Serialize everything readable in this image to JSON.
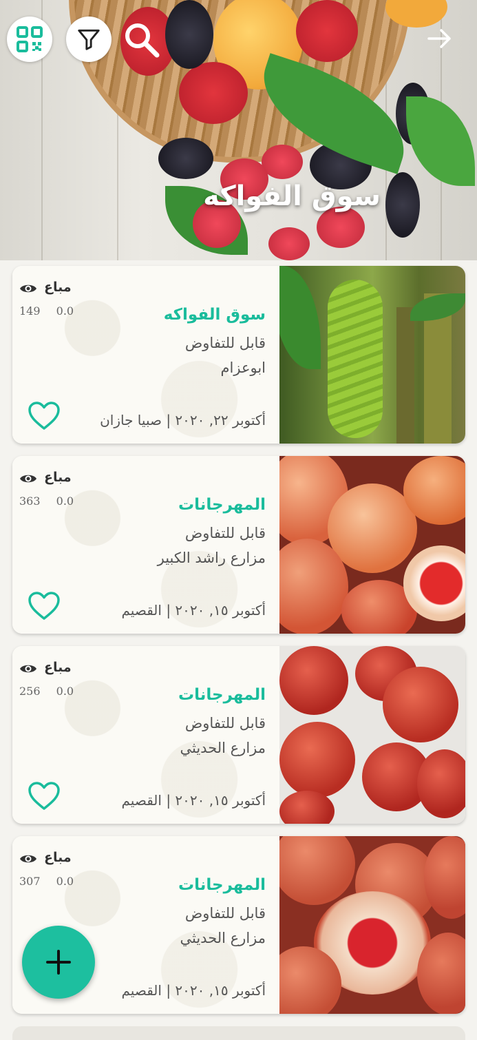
{
  "header": {
    "title": "سوق الفواكه",
    "icons": [
      "qr-code-icon",
      "filter-icon",
      "search-icon",
      "arrow-right-icon"
    ]
  },
  "products": [
    {
      "title": "سوق الفواكه",
      "negotiable": "قابل للتفاوض",
      "seller": "ابوعزام",
      "meta": "أكتوبر ٢٢, ٢٠٢٠ | صبيا جازان",
      "sold_label": "مباع",
      "rating": "0.0",
      "views": "149",
      "image": "bananas"
    },
    {
      "title": "المهرجانات",
      "negotiable": "قابل للتفاوض",
      "seller": "مزارع راشد الكبير",
      "meta": "أكتوبر ١٥, ٢٠٢٠ | القصيم",
      "sold_label": "مباع",
      "rating": "0.0",
      "views": "363",
      "image": "pomegranates"
    },
    {
      "title": "المهرجانات",
      "negotiable": "قابل للتفاوض",
      "seller": "مزارع الحديثي",
      "meta": "أكتوبر ١٥, ٢٠٢٠ | القصيم",
      "sold_label": "مباع",
      "rating": "0.0",
      "views": "256",
      "image": "pomegranates-crate"
    },
    {
      "title": "المهرجانات",
      "negotiable": "قابل للتفاوض",
      "seller": "مزارع الحديثي",
      "meta": "أكتوبر ١٥, ٢٠٢٠ | القصيم",
      "sold_label": "مباع",
      "rating": "0.0",
      "views": "307",
      "image": "pomegranates-open"
    }
  ],
  "fab": {
    "icon": "plus-icon"
  },
  "colors": {
    "accent": "#1abc9c",
    "fab": "#1dbf9f",
    "background": "#f4f3ef"
  }
}
